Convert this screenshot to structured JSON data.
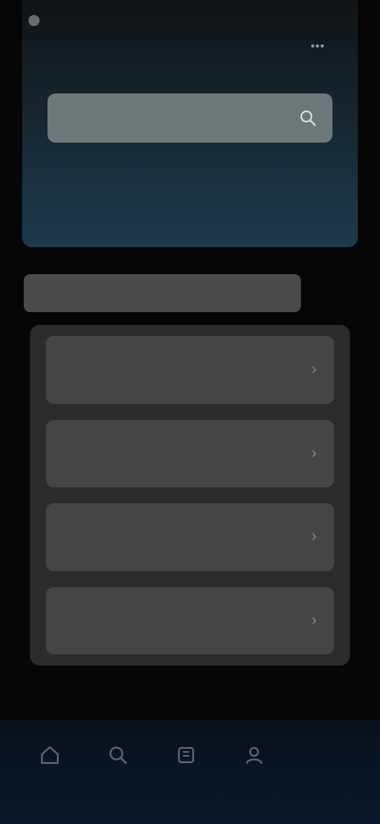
{
  "status": {
    "time": ""
  },
  "header": {
    "title": "",
    "action_icon": "more-icon"
  },
  "search": {
    "placeholder": "",
    "icon": "search-icon"
  },
  "summary": {
    "primary_value": "",
    "primary_label": "",
    "side_value": "",
    "side_label": ""
  },
  "section": {
    "title": ""
  },
  "list": {
    "items": [
      {
        "label": ""
      },
      {
        "label": ""
      },
      {
        "label": ""
      },
      {
        "label": ""
      }
    ]
  },
  "nav": {
    "items": [
      {
        "label": "",
        "icon": "home-icon"
      },
      {
        "label": "",
        "icon": "search-icon"
      },
      {
        "label": "",
        "icon": "library-icon"
      },
      {
        "label": "",
        "icon": "profile-icon"
      }
    ]
  },
  "colors": {
    "top_panel_accent": "#1c3a4d",
    "nav_background": "#0b1626",
    "card_background": "#454545"
  }
}
